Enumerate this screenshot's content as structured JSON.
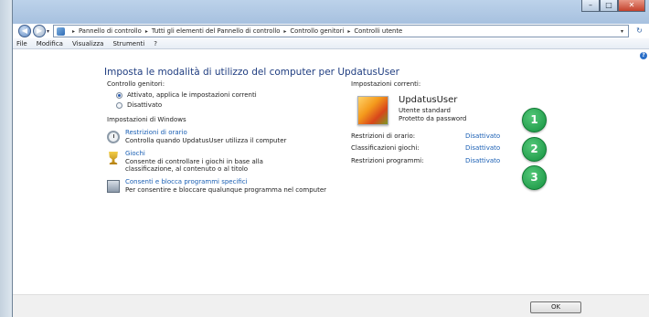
{
  "address": {
    "crumbs": [
      "Pannello di controllo",
      "Tutti gli elementi del Pannello di controllo",
      "Controllo genitori",
      "Controlli utente"
    ]
  },
  "menu": [
    "File",
    "Modifica",
    "Visualizza",
    "Strumenti",
    "?"
  ],
  "page_title": "Imposta le modalità di utilizzo del computer per UpdatusUser",
  "parental_controls": {
    "label": "Controllo genitori:",
    "options": [
      "Attivato, applica le impostazioni correnti",
      "Disattivato"
    ],
    "selected": "Attivato, applica le impostazioni correnti"
  },
  "windows_settings": {
    "label": "Impostazioni di Windows",
    "items": [
      {
        "title": "Restrizioni di orario",
        "desc": "Controlla quando UpdatusUser utilizza il computer",
        "icon": "clock-icon"
      },
      {
        "title": "Giochi",
        "desc": "Consente di controllare i giochi in base alla classificazione, al contenuto o al titolo",
        "icon": "trophy-icon"
      },
      {
        "title": "Consenti e blocca programmi specifici",
        "desc": "Per consentire e bloccare qualunque programma nel computer",
        "icon": "program-icon"
      }
    ]
  },
  "current_settings": {
    "label": "Impostazioni correnti:",
    "user_name": "UpdatusUser",
    "user_type": "Utente standard",
    "user_protection": "Protetto da password",
    "rows": [
      {
        "label": "Restrizioni di orario:",
        "value": "Disattivato"
      },
      {
        "label": "Classificazioni giochi:",
        "value": "Disattivato"
      },
      {
        "label": "Restrizioni programmi:",
        "value": "Disattivato"
      }
    ]
  },
  "badges": [
    "1",
    "2",
    "3"
  ],
  "ok_label": "OK",
  "colors": {
    "link": "#1a5fb4",
    "title": "#1f3d80",
    "badge": "#1fa04b"
  }
}
